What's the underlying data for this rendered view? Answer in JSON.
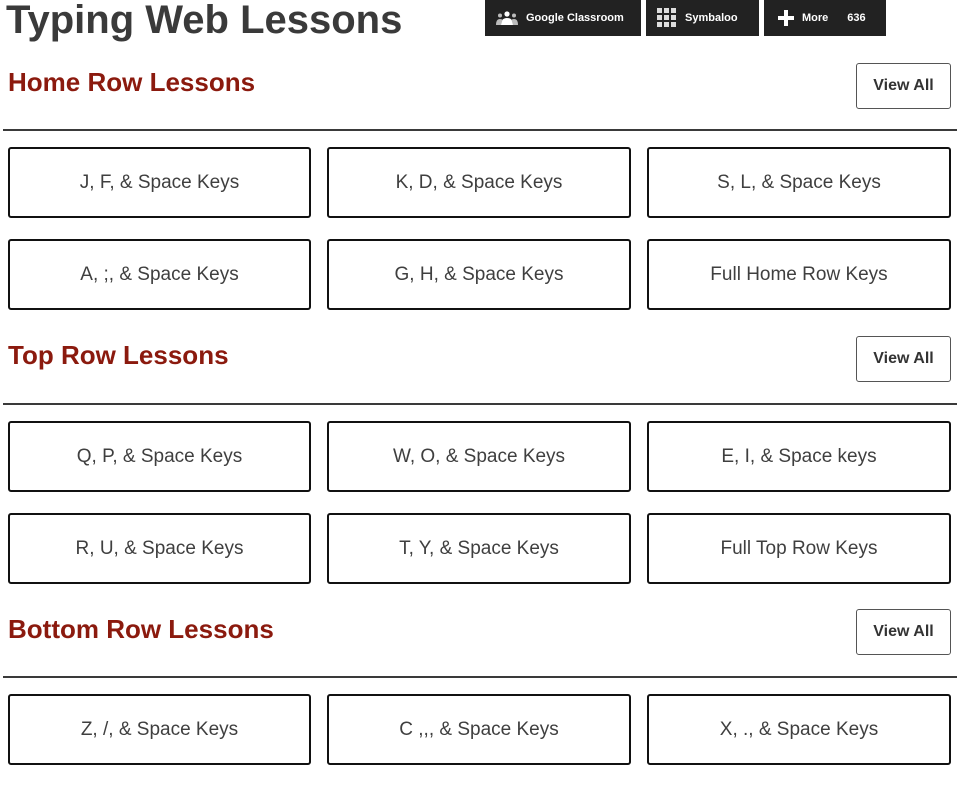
{
  "page": {
    "title": "Typing Web Lessons"
  },
  "sharebar": {
    "google_classroom": {
      "label": "Google Classroom",
      "icon": "google-classroom-icon"
    },
    "symbaloo": {
      "label": "Symbaloo",
      "icon": "grid-icon"
    },
    "more": {
      "label": "More",
      "count": "636",
      "icon": "plus-icon"
    }
  },
  "colors": {
    "section_title": "#8b1a0e",
    "sharebar_bg": "#222222",
    "title": "#3a3a3a"
  },
  "sections": [
    {
      "title": "Home Row Lessons",
      "view_all": "View All",
      "lessons": [
        "J, F, & Space Keys",
        "K, D, & Space Keys",
        "S, L, & Space Keys",
        "A, ;, & Space Keys",
        "G, H, & Space Keys",
        "Full Home Row Keys"
      ]
    },
    {
      "title": "Top Row Lessons",
      "view_all": "View All",
      "lessons": [
        "Q, P, & Space Keys",
        "W, O, & Space Keys",
        "E, I, & Space keys",
        "R, U, & Space Keys",
        "T, Y, & Space Keys",
        "Full Top Row Keys"
      ]
    },
    {
      "title": "Bottom Row Lessons",
      "view_all": "View All",
      "lessons": [
        "Z, /, & Space Keys",
        "C ,,, & Space Keys",
        "X, ., & Space Keys"
      ]
    }
  ]
}
